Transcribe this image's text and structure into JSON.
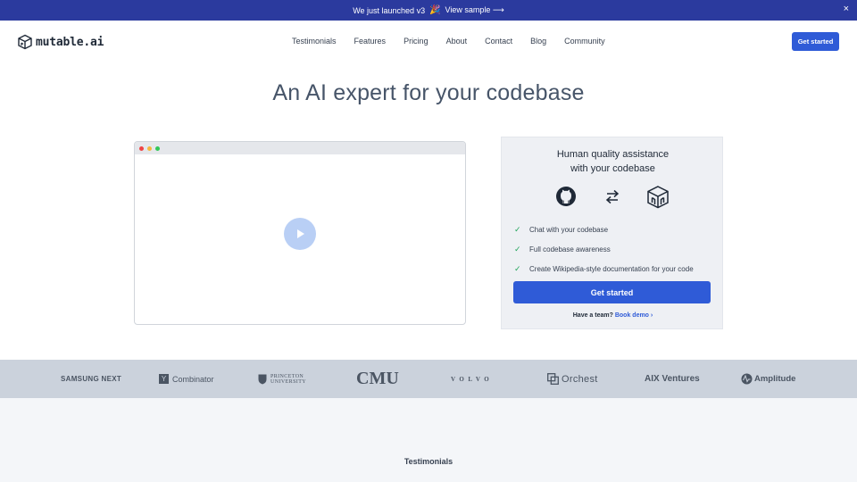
{
  "banner": {
    "text": "We just launched v3",
    "emoji": "🎉",
    "link": "View sample ⟶",
    "close": "×"
  },
  "nav": {
    "logo_text": "mutable.ai",
    "links": [
      "Testimonials",
      "Features",
      "Pricing",
      "About",
      "Contact",
      "Blog",
      "Community"
    ],
    "cta": "Get started"
  },
  "hero": {
    "title": "An AI expert for your codebase"
  },
  "card": {
    "title_line1": "Human quality assistance",
    "title_line2": "with your codebase",
    "features": [
      "Chat with your codebase",
      "Full codebase awareness",
      "Create Wikipedia-style documentation for your code"
    ],
    "button": "Get started",
    "team_text": "Have a team?",
    "team_link": "Book demo ›"
  },
  "logos": {
    "samsung": "SAMSUNG NEXT",
    "yc_mark": "Y",
    "yc": "Combinator",
    "princeton_1": "PRINCETON",
    "princeton_2": "UNIVERSITY",
    "cmu": "CMU",
    "volvo": "VOLVO",
    "orchest": "Orchest",
    "aix": "AIX Ventures",
    "amplitude": "Amplitude"
  },
  "sections": {
    "testimonials": "Testimonials"
  },
  "colors": {
    "banner": "#2b3a9e",
    "accent": "#2f5bd7",
    "check": "#22a55b",
    "logo_band": "#cbd2dc"
  }
}
